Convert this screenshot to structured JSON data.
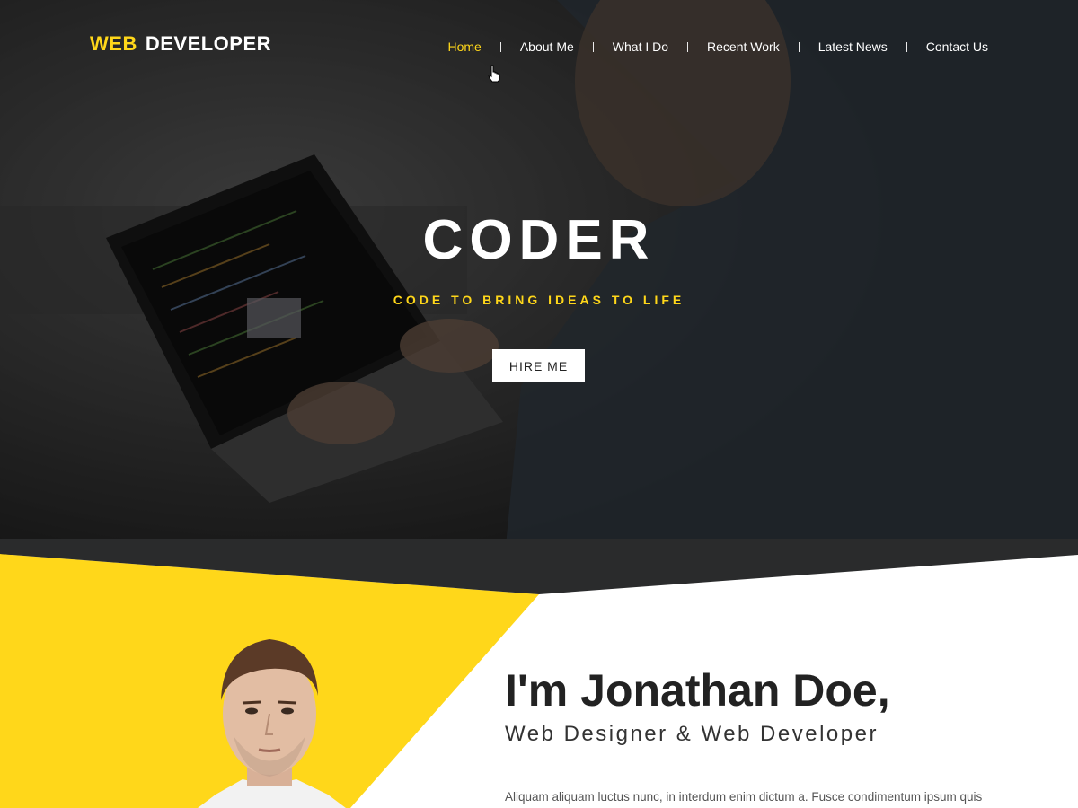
{
  "brand": {
    "logo_accent": "WEB",
    "logo_rest": "DEVELOPER"
  },
  "nav": {
    "items": [
      {
        "label": "Home"
      },
      {
        "label": "About Me"
      },
      {
        "label": "What I Do"
      },
      {
        "label": "Recent Work"
      },
      {
        "label": "Latest News"
      },
      {
        "label": "Contact Us"
      }
    ]
  },
  "hero": {
    "title": "CODER",
    "tagline": "CODE TO BRING IDEAS TO LIFE",
    "button": "HIRE ME"
  },
  "about": {
    "name": "I'm Jonathan Doe,",
    "role": "Web Designer & Web Developer",
    "text": "Aliquam aliquam luctus nunc, in interdum enim dictum a. Fusce condimentum ipsum quis aliquet convallis. Sed tempor nibh ac dui finibus rutrum bibendum nec eros. Nam malesuada"
  },
  "colors": {
    "accent": "#ffd71a",
    "hero_overlay": "#222222",
    "text_dark": "#222222",
    "text_body": "#555555"
  },
  "icons": {
    "cursor": "hand-pointer-icon"
  }
}
